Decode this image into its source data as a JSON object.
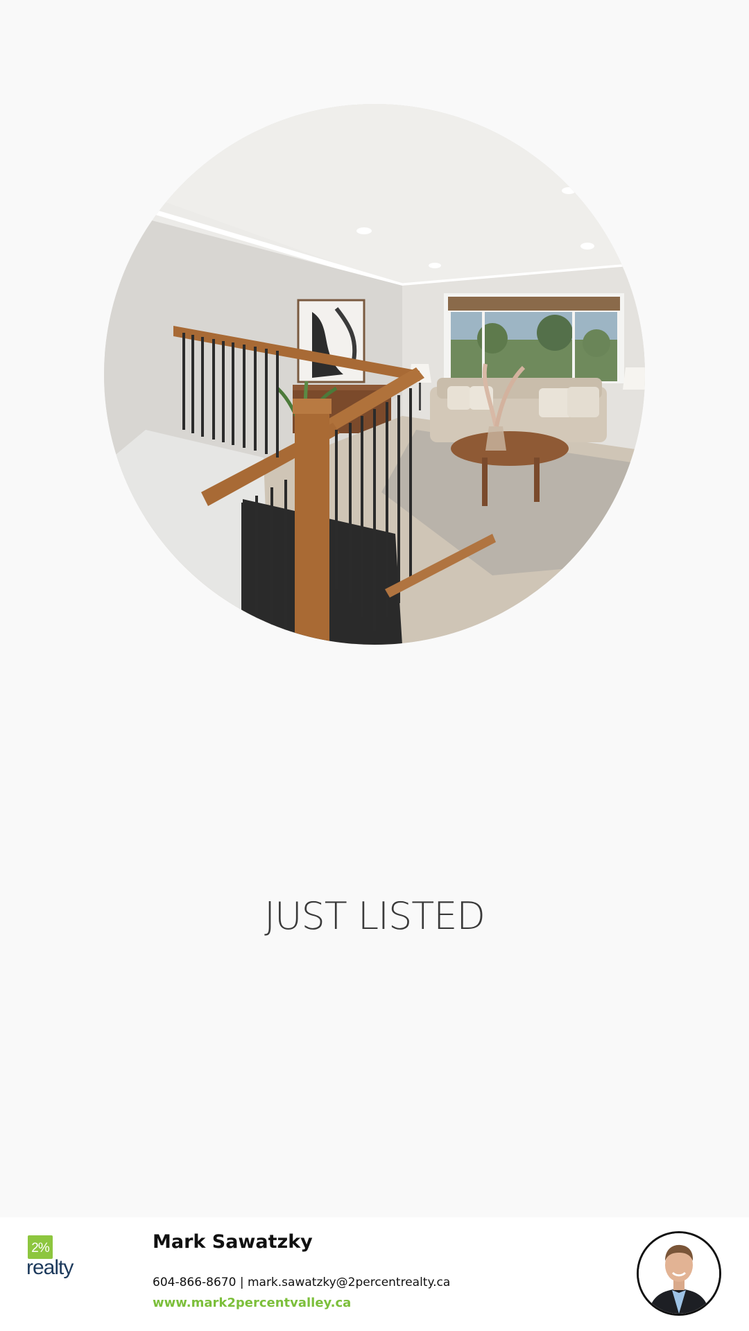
{
  "hero": {
    "image": "living-room-with-staircase-photo"
  },
  "headline": "JUST LISTED",
  "footer": {
    "logo": {
      "badge_text": "2%",
      "word_text": "realty",
      "badge_color": "#8dc63f",
      "word_color": "#1d3a5c"
    },
    "agent_name": "Mark Sawatzky",
    "contact_line": "604-866-8670 | mark.sawatzky@2percentrealty.ca",
    "website": "www.mark2percentvalley.ca",
    "website_color": "#7cbf3b",
    "avatar": "agent-headshot"
  }
}
